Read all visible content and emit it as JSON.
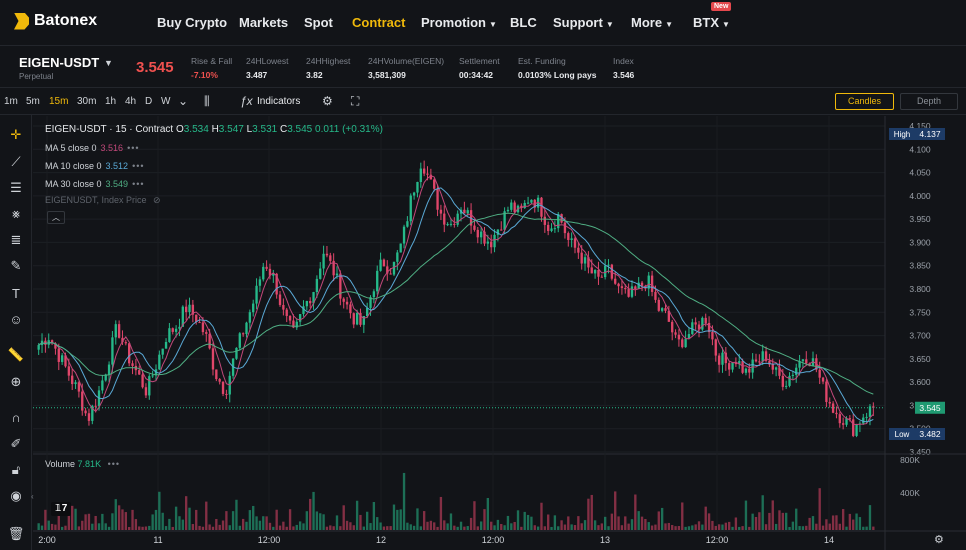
{
  "nav": {
    "brand": "Batonex",
    "items": [
      {
        "label": "Buy Crypto",
        "active": false,
        "caret": false
      },
      {
        "label": "Markets",
        "active": false,
        "caret": false
      },
      {
        "label": "Spot",
        "active": false,
        "caret": false
      },
      {
        "label": "Contract",
        "active": true,
        "caret": false
      },
      {
        "label": "Promotion",
        "active": false,
        "caret": true
      },
      {
        "label": "BLC",
        "active": false,
        "caret": false
      },
      {
        "label": "Support",
        "active": false,
        "caret": true
      },
      {
        "label": "More",
        "active": false,
        "caret": true
      },
      {
        "label": "BTX",
        "active": false,
        "caret": true
      }
    ],
    "new_badge": "New"
  },
  "ticker": {
    "symbol": "EIGEN-USDT",
    "type": "Perpetual",
    "last_price": "3.545",
    "stats": [
      {
        "label": "Rise & Fall",
        "value": "-7.10%",
        "red": true
      },
      {
        "label": "24HLowest",
        "value": "3.487",
        "red": false
      },
      {
        "label": "24HHighest",
        "value": "3.82",
        "red": false
      },
      {
        "label": "24HVolume(EIGEN)",
        "value": "3,581,309",
        "red": false
      },
      {
        "label": "Settlement",
        "value": "00:34:42",
        "red": false
      },
      {
        "label": "Est. Funding",
        "value": "0.0103%  Long pays",
        "red": false
      },
      {
        "label": "Index",
        "value": "3.546",
        "red": false
      }
    ]
  },
  "toolbar": {
    "timeframes": [
      "1m",
      "5m",
      "15m",
      "30m",
      "1h",
      "4h",
      "D",
      "W"
    ],
    "active_timeframe": "15m",
    "indicators_label": "Indicators",
    "candles_label": "Candles",
    "depth_label": "Depth"
  },
  "legend": {
    "title": "EIGEN-USDT · 15 · Contract",
    "o_label": "O",
    "o": "3.534",
    "h_label": "H",
    "h": "3.547",
    "l_label": "L",
    "l": "3.531",
    "c_label": "C",
    "c": "3.545",
    "change": "0.011 (+0.31%)",
    "ma": [
      {
        "label": "MA 5 close 0",
        "value": "3.516",
        "color": "#c2487a"
      },
      {
        "label": "MA 10 close 0",
        "value": "3.512",
        "color": "#5aa9d6"
      },
      {
        "label": "MA 30 close 0",
        "value": "3.549",
        "color": "#4fae83"
      }
    ],
    "index_line": "EIGENUSDT, Index Price",
    "volume_label": "Volume",
    "volume_value": "7.81K"
  },
  "chart_data": {
    "type": "candlestick",
    "y_ticks": [
      "4.150",
      "4.100",
      "4.050",
      "4.000",
      "3.950",
      "3.900",
      "3.850",
      "3.800",
      "3.750",
      "3.700",
      "3.650",
      "3.600",
      "3.550",
      "3.500",
      "3.450"
    ],
    "ylim": [
      3.45,
      4.15
    ],
    "x_ticks": [
      "2:00",
      "11",
      "12:00",
      "12",
      "12:00",
      "13",
      "12:00",
      "14"
    ],
    "volume_ticks": [
      "800K",
      "400K"
    ],
    "high_label": "High",
    "high_value": "4.137",
    "low_label": "Low",
    "low_value": "3.482",
    "current_value": "3.545",
    "close_path": [
      3.68,
      3.7,
      3.66,
      3.62,
      3.58,
      3.52,
      3.57,
      3.64,
      3.72,
      3.66,
      3.62,
      3.58,
      3.64,
      3.7,
      3.72,
      3.76,
      3.74,
      3.7,
      3.62,
      3.58,
      3.66,
      3.72,
      3.78,
      3.86,
      3.82,
      3.74,
      3.7,
      3.76,
      3.8,
      3.88,
      3.84,
      3.78,
      3.74,
      3.72,
      3.8,
      3.86,
      3.84,
      3.9,
      4.0,
      4.08,
      4.02,
      3.96,
      3.94,
      3.98,
      3.95,
      3.92,
      3.9,
      3.94,
      3.98,
      3.96,
      4.0,
      3.98,
      3.93,
      3.96,
      3.9,
      3.88,
      3.84,
      3.82,
      3.84,
      3.8,
      3.78,
      3.8,
      3.82,
      3.76,
      3.74,
      3.68,
      3.7,
      3.72,
      3.74,
      3.66,
      3.64,
      3.65,
      3.62,
      3.64,
      3.66,
      3.62,
      3.6,
      3.63,
      3.66,
      3.64,
      3.58,
      3.54,
      3.52,
      3.5,
      3.53,
      3.545
    ],
    "ma_colors": {
      "ma5": "#c2487a",
      "ma10": "#5aa9d6",
      "ma30": "#4fae83"
    },
    "up_color": "#26b98a",
    "down_color": "#e0466a"
  },
  "colors": {
    "accent": "#f0b90b",
    "red": "#f0514f",
    "green": "#26b98a",
    "bg": "#121418"
  }
}
